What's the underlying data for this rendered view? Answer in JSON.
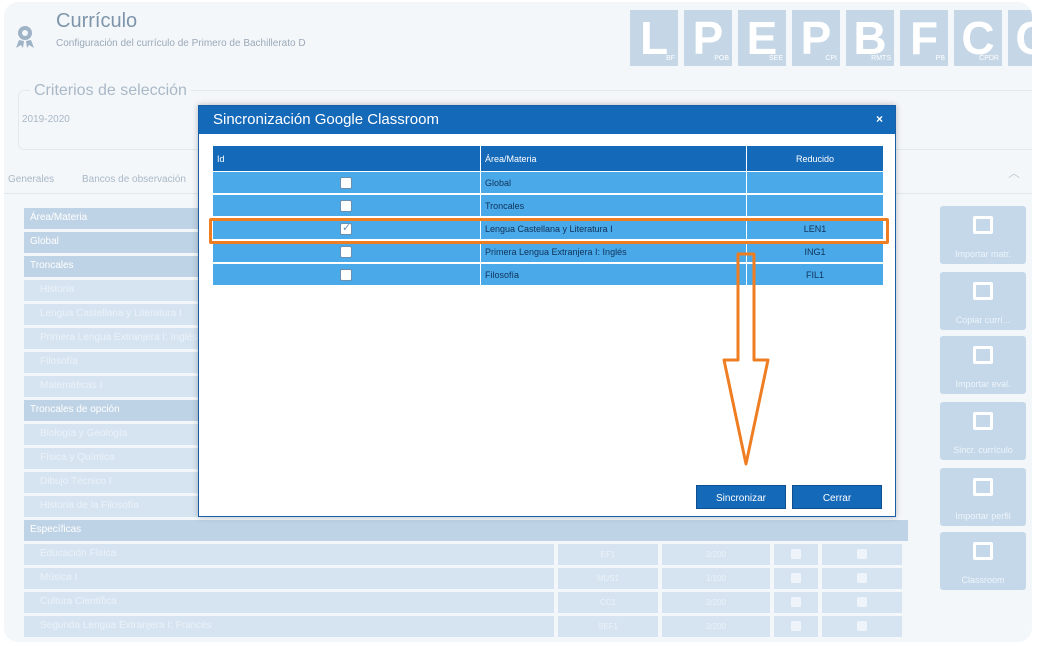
{
  "header": {
    "title": "Currículo",
    "subtitle": "Configuración del currículo de Primero de Bachillerato D",
    "logos": [
      {
        "letter": "L",
        "sub": "BF"
      },
      {
        "letter": "P",
        "sub": "POB"
      },
      {
        "letter": "E",
        "sub": "SEE"
      },
      {
        "letter": "P",
        "sub": "CPI"
      },
      {
        "letter": "B",
        "sub": "RMTS"
      },
      {
        "letter": "F",
        "sub": "PB"
      },
      {
        "letter": "C",
        "sub": "CPDR"
      },
      {
        "letter": "C",
        "sub": "CS"
      }
    ]
  },
  "criteria": {
    "legend": "Criterios de selección",
    "year": "2019-2020"
  },
  "tabs": [
    "Generales",
    "Bancos de observación"
  ],
  "background_table": {
    "header": "Área/Materia",
    "rows": [
      {
        "label": "Global",
        "style": "dark"
      },
      {
        "label": "Troncales",
        "style": "dark"
      },
      {
        "label": "Historia",
        "style": "light"
      },
      {
        "label": "Lengua Castellana y Literatura I",
        "style": "light"
      },
      {
        "label": "Primera Lengua Extranjera I: Inglés",
        "style": "light"
      },
      {
        "label": "Filosofía",
        "style": "light"
      },
      {
        "label": "Matemáticas I",
        "style": "light"
      },
      {
        "label": "Troncales de opción",
        "style": "dark"
      },
      {
        "label": "Biología y Geología",
        "style": "light"
      },
      {
        "label": "Física y Química",
        "style": "light"
      },
      {
        "label": "Dibujo Técnico I",
        "style": "light"
      },
      {
        "label": "Historia de la Filosofía",
        "style": "light"
      },
      {
        "label": "Específicas",
        "style": "dark"
      },
      {
        "label": "Educación Física",
        "style": "light"
      },
      {
        "label": "Música I",
        "style": "light"
      },
      {
        "label": "Cultura Científica",
        "style": "light"
      },
      {
        "label": "Segunda Lengua Extranjera I: Francés",
        "style": "light"
      }
    ],
    "codes": [
      "EF1",
      "MUS1",
      "CC1",
      "SEF1"
    ],
    "values": [
      "2/200",
      "1/100",
      "2/200",
      "2/200"
    ]
  },
  "side_buttons": [
    {
      "label": "Importar matr."
    },
    {
      "label": "Copiar currí..."
    },
    {
      "label": "Importar eval."
    },
    {
      "label": "Sincr. currículo"
    },
    {
      "label": "Importar perfil"
    },
    {
      "label": "Classroom"
    }
  ],
  "modal": {
    "title": "Sincronización Google Classroom",
    "close": "×",
    "columns": [
      "Id",
      "Área/Materia",
      "Reducido"
    ],
    "rows": [
      {
        "subject": "Global",
        "short": "",
        "checked": false
      },
      {
        "subject": "Troncales",
        "short": "",
        "checked": false
      },
      {
        "subject": "Lengua Castellana y Literatura I",
        "short": "LEN1",
        "checked": true
      },
      {
        "subject": "Primera Lengua Extranjera I: Inglés",
        "short": "ING1",
        "checked": false
      },
      {
        "subject": "Filosofía",
        "short": "FIL1",
        "checked": false
      }
    ],
    "sync_button": "Sincronizar",
    "close_button": "Cerrar"
  },
  "colors": {
    "accent": "#1569b9",
    "row": "#4aa9e8",
    "highlight": "#ef7d22"
  }
}
